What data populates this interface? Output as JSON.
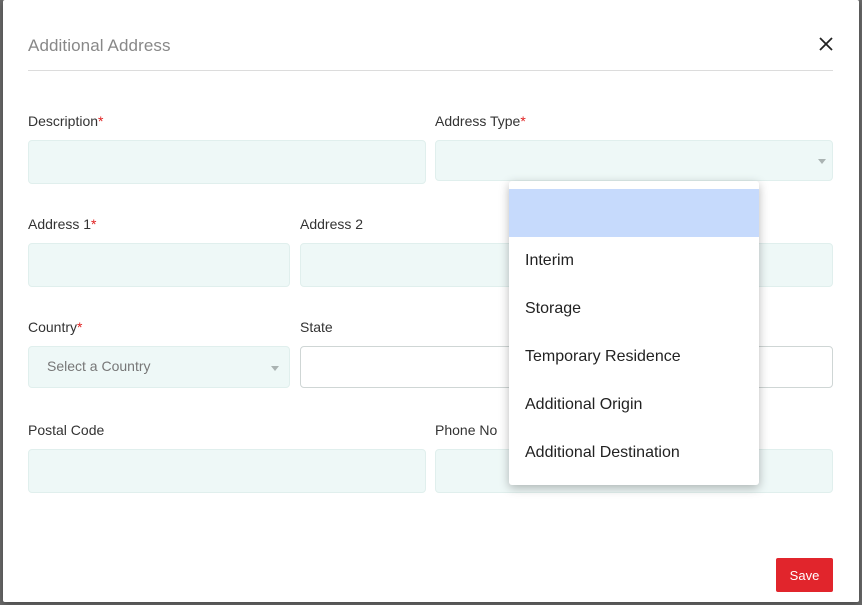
{
  "modal": {
    "title": "Additional Address",
    "save_label": "Save"
  },
  "form": {
    "description_label": "Description",
    "address_type_label": "Address Type",
    "address1_label": "Address 1",
    "address2_label": "Address 2",
    "country_label": "Country",
    "country_placeholder": "Select a Country",
    "state_label": "State",
    "postal_code_label": "Postal Code",
    "phone_label": "Phone No",
    "required_marker": "*"
  },
  "address_type_dropdown": {
    "options": [
      "",
      "Interim",
      "Storage",
      "Temporary Residence",
      "Additional Origin",
      "Additional Destination"
    ],
    "highlighted_index": 0
  },
  "colors": {
    "accent": "#e1252c",
    "input_bg": "#eef8f7",
    "highlight": "#c6dafc"
  }
}
